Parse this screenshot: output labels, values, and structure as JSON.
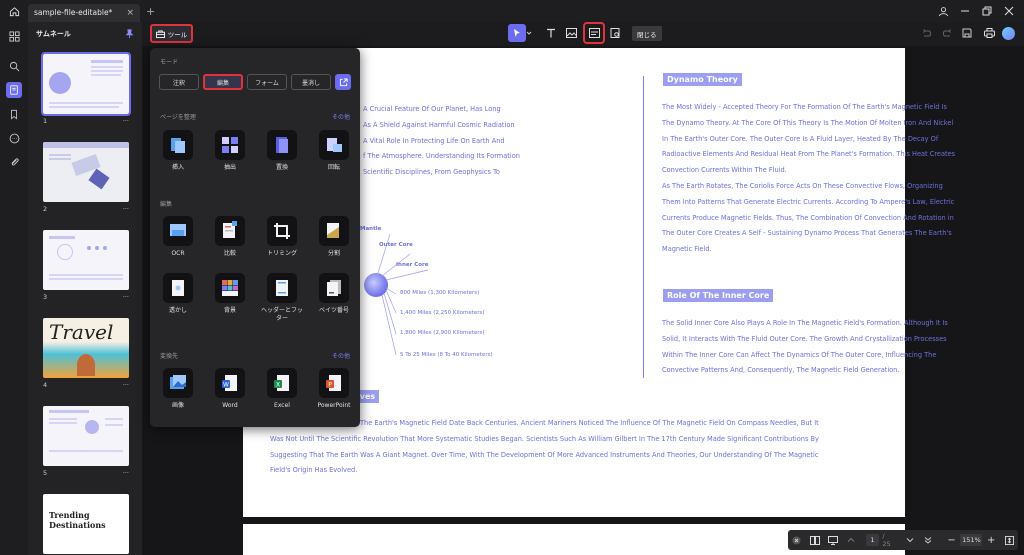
{
  "titlebar": {
    "tab_title": "sample-file-editable*",
    "tab_close": "×",
    "new_tab": "+"
  },
  "thumbnails": {
    "title": "サムネール",
    "pages": [
      {
        "number": "1",
        "more": "···"
      },
      {
        "number": "2",
        "more": "···"
      },
      {
        "number": "3",
        "more": "···"
      },
      {
        "number": "4",
        "more": "···",
        "big_text": "Travel"
      },
      {
        "number": "5",
        "more": "···"
      },
      {
        "number": "",
        "more": "",
        "big_text": "Trending Destinations"
      }
    ]
  },
  "toolbar": {
    "tools_label": "ツール",
    "close_label": "閉じる"
  },
  "popup": {
    "mode_title": "モード",
    "modes": [
      "注釈",
      "編集",
      "フォーム",
      "墨消し"
    ],
    "active_mode": "編集",
    "pages_title": "ページを整理",
    "pages_more": "その他",
    "page_tools": [
      "挿入",
      "抽出",
      "置換",
      "回転"
    ],
    "edit_title": "編集",
    "edit_tools_row1": [
      "OCR",
      "比較",
      "トリミング",
      "分割"
    ],
    "edit_tools_row2": [
      "透かし",
      "背景",
      "ヘッダーとフッター",
      "ベイツ番号"
    ],
    "convert_title": "変換先",
    "convert_more": "その他",
    "convert_tools": [
      "画像",
      "Word",
      "Excel",
      "PowerPoint"
    ]
  },
  "document": {
    "left_lines": [
      "A Crucial Feature Of Our Planet, Has Long",
      "As A Shield Against Harmful Cosmic Radiation",
      "A Vital Role In Protecting Life On Earth And",
      "f The Atmosphere. Understanding Its Formation",
      "Scientific Disciplines, From Geophysics To"
    ],
    "diagram_labels": {
      "mantle": "Mantle",
      "outer_core": "Outer Core",
      "inner_core": "Inner Core",
      "d1": "800 Miles (1,300 Kilometers)",
      "d2": "1,400 Miles (2,250 Kilometers)",
      "d3": "1,800 Miles (2,900 Kilometers)",
      "d4": "5 To 25 Miles (8 To 40 Kilometers)"
    },
    "dynamo_title": "Dynamo Theory",
    "dynamo_lines": [
      "The Most Widely - Accepted Theory For The Formation Of The Earth's Magnetic Field Is",
      "The Dynamo Theory. At The Core Of This Theory Is The Motion Of Molten Iron And Nickel",
      "In The Earth's Outer Core. The Outer Core Is A Fluid Layer, Heated By The Decay Of",
      "Radioactive Elements And Residual Heat From The Planet's Formation. This Heat Creates",
      "Convection Currents Within The Fluid.",
      "As The Earth Rotates, The Coriolis Force Acts On These Convective Flows, Organizing",
      "Them Into Patterns That Generate Electric Currents. According To Ampere's Law, Electric",
      "Currents Produce Magnetic Fields. Thus, The Combination Of Convection And Rotation in",
      "The Outer Core Creates A Self - Sustaining Dynamo Process That Generates The Earth's",
      "Magnetic Field."
    ],
    "inner_title": "Role Of The Inner Core",
    "inner_lines": [
      "The Solid Inner Core Also Plays A Role In The Magnetic Field's Formation. Although It Is",
      "Solid, It Interacts With The Fluid Outer Core. The Growth And Crystallization Processes",
      "Within The Inner Core Can Affect The Dynamics Of The Outer Core, Influencing The",
      "Convective Patterns And, Consequently, The Magnetic Field Generation."
    ],
    "bottom_heading": "ives",
    "bottom_lines": [
      "The Earth's Magnetic Field Date Back Centuries. Ancient Mariners Noticed The Influence Of The Magnetic Field On Compass Needles, But It",
      "Was Not Until The Scientific Revolution That More Systematic Studies Began. Scientists Such As William Gilbert In The 17th Century Made Significant Contributions By",
      "Suggesting That The Earth Was A Giant Magnet. Over Time, With The Development Of More Advanced Instruments And Theories, Our Understanding Of The Magnetic",
      "Field's Origin Has Evolved."
    ]
  },
  "bottombar": {
    "page": "1",
    "total": "/ 25",
    "zoom": "151%",
    "minus": "−",
    "plus": "+"
  },
  "colors": {
    "accent": "#6b6cf0",
    "highlight_red": "#e0343a",
    "doc_text": "#6d6fdc"
  }
}
